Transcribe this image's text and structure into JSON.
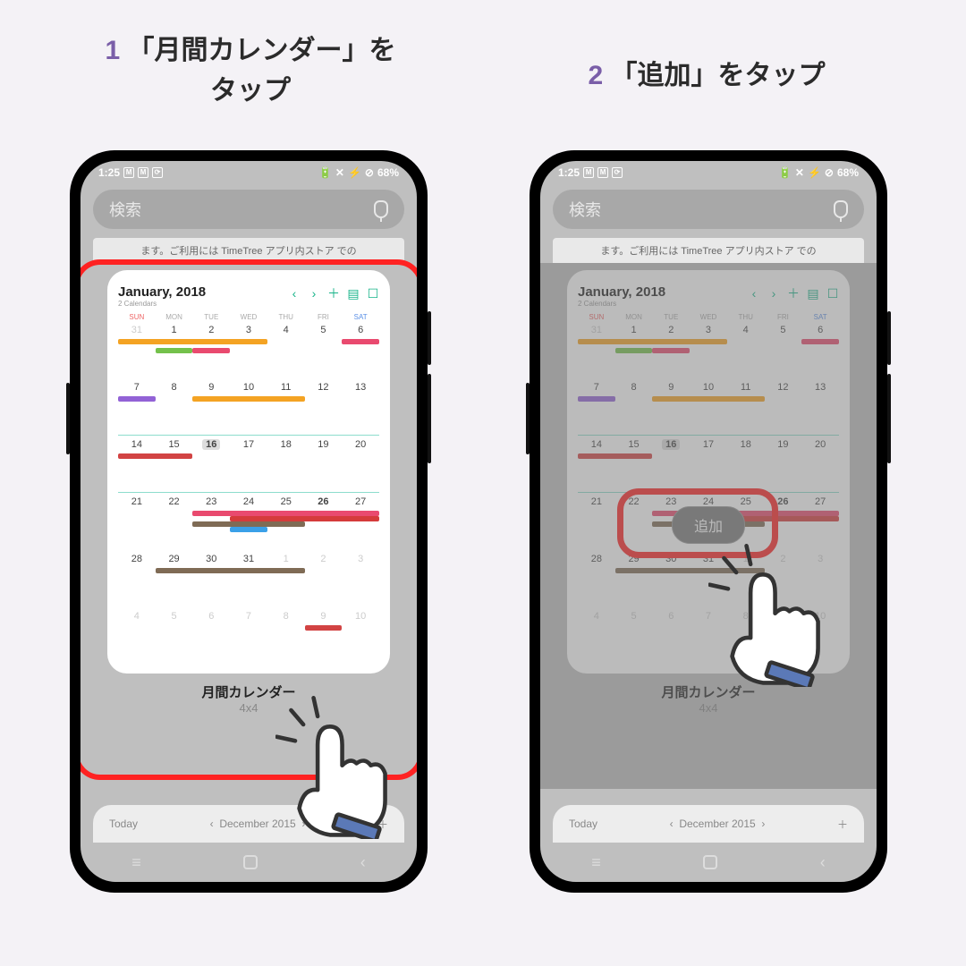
{
  "captions": {
    "step1_num": "1",
    "step1": "「月間カレンダー」を\nタップ",
    "step2_num": "2",
    "step2": "「追加」をタップ"
  },
  "status": {
    "time": "1:25",
    "battery": "68%"
  },
  "search": {
    "placeholder": "検索"
  },
  "banner": "ます。ご利用には TimeTree アプリ内ストア での",
  "calendar": {
    "month": "January, 2018",
    "sub": "2 Calendars",
    "days": [
      "SUN",
      "MON",
      "TUE",
      "WED",
      "THU",
      "FRI",
      "SAT"
    ],
    "weeks": [
      [
        "31",
        "1",
        "2",
        "3",
        "4",
        "5",
        "6"
      ],
      [
        "7",
        "8",
        "9",
        "10",
        "11",
        "12",
        "13"
      ],
      [
        "14",
        "15",
        "16",
        "17",
        "18",
        "19",
        "20"
      ],
      [
        "21",
        "22",
        "23",
        "24",
        "25",
        "26",
        "27"
      ],
      [
        "28",
        "29",
        "30",
        "31",
        "1",
        "2",
        "3"
      ],
      [
        "4",
        "5",
        "6",
        "7",
        "8",
        "9",
        "10"
      ]
    ]
  },
  "widget": {
    "name": "月間カレンダー",
    "size": "4x4"
  },
  "strip": {
    "today": "Today",
    "month": "December 2015"
  },
  "add_button": "追加"
}
